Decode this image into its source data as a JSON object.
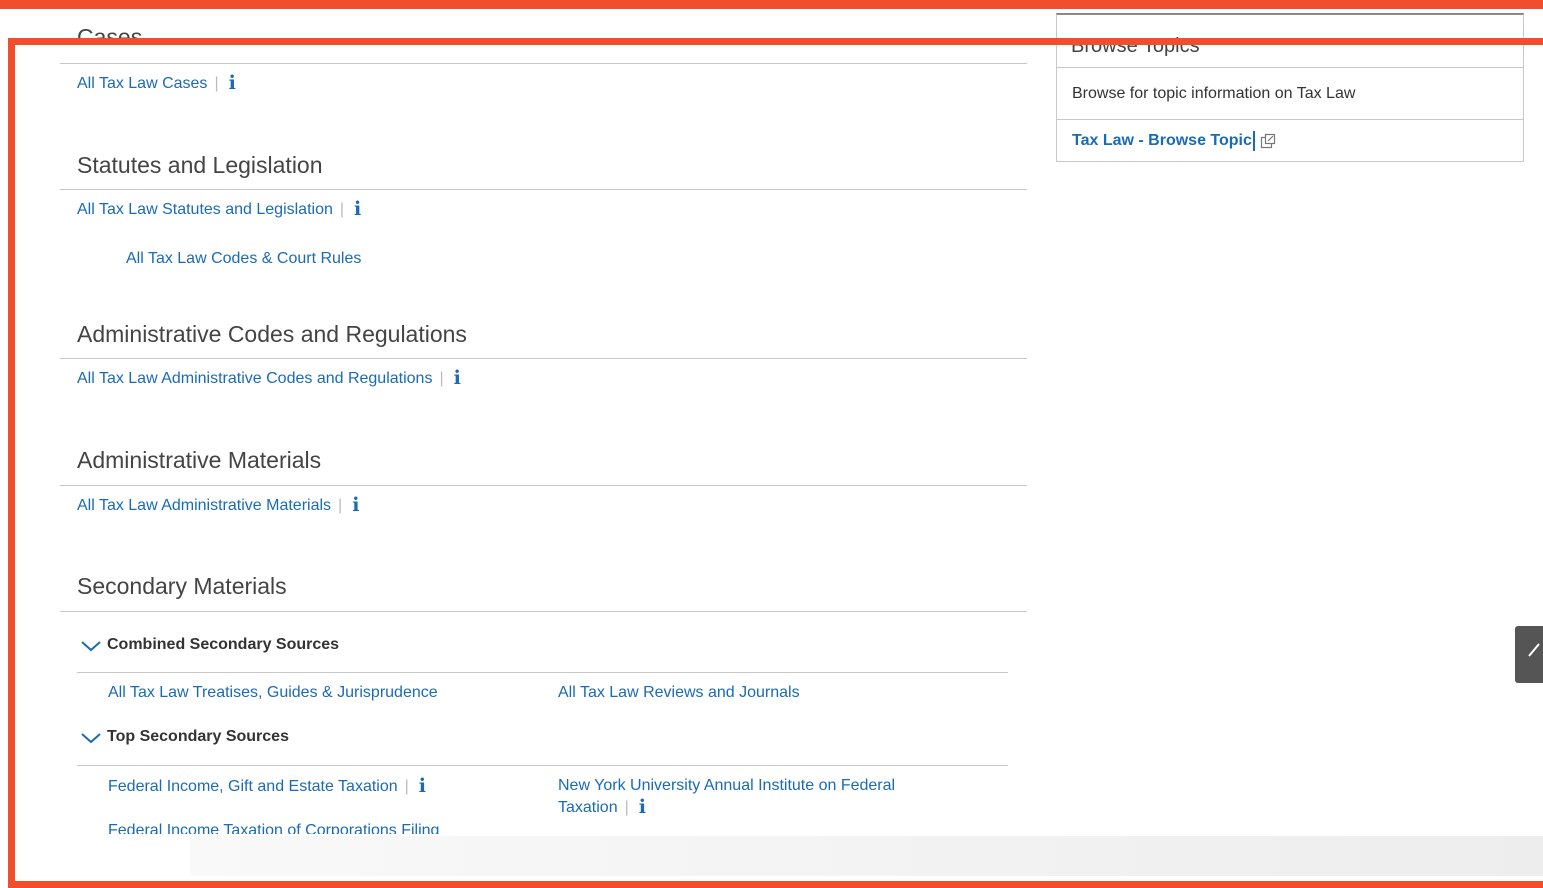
{
  "sections": {
    "cases": {
      "title": "Cases",
      "links": [
        "All Tax Law Cases"
      ]
    },
    "statutes": {
      "title": "Statutes and Legislation",
      "links": [
        "All Tax Law Statutes and Legislation"
      ],
      "sub_links": [
        "All Tax Law Codes & Court Rules"
      ]
    },
    "admin_codes": {
      "title": "Administrative Codes and Regulations",
      "links": [
        "All Tax Law Administrative Codes and Regulations"
      ]
    },
    "admin_materials": {
      "title": "Administrative Materials",
      "links": [
        "All Tax Law Administrative Materials"
      ]
    },
    "secondary": {
      "title": "Secondary Materials",
      "groups": [
        {
          "label": "Combined Secondary Sources",
          "links": [
            "All Tax Law Treatises, Guides & Jurisprudence",
            "All Tax Law Reviews and Journals"
          ]
        },
        {
          "label": "Top Secondary Sources",
          "links": [
            "Federal Income, Gift and Estate Taxation",
            "New York University Annual Institute on Federal",
            "Taxation",
            "Federal Income Taxation of Corporations Filing"
          ]
        }
      ]
    }
  },
  "separator": "|",
  "info_glyph": "i",
  "sidebar": {
    "title": "Browse Topics",
    "description": "Browse for topic information on Tax Law",
    "link_label": "Tax Law - Browse Topic"
  },
  "icons": {
    "info": "info-icon",
    "chevron": "chevron-down-icon",
    "external": "external-link-icon",
    "scroll_top": "arrow-up-icon"
  },
  "colors": {
    "link": "#1a6bb5",
    "highlight": "#f04e2d",
    "rule": "#c8c8c8"
  }
}
